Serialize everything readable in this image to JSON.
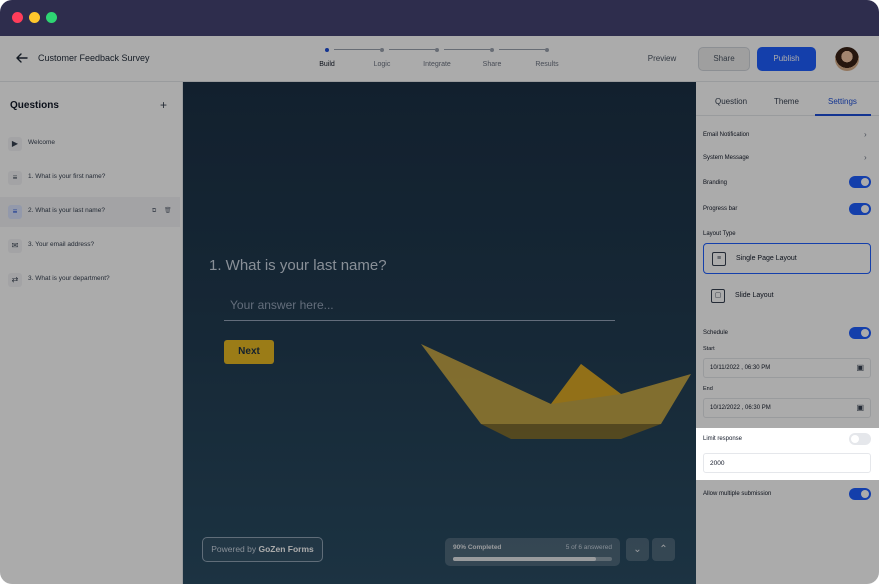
{
  "header": {
    "title": "Customer Feedback Survey",
    "steps": [
      {
        "label": "Build",
        "active": true
      },
      {
        "label": "Logic",
        "active": false
      },
      {
        "label": "Integrate",
        "active": false
      },
      {
        "label": "Share",
        "active": false
      },
      {
        "label": "Results",
        "active": false
      }
    ],
    "preview_label": "Preview",
    "share_label": "Share",
    "publish_label": "Publish"
  },
  "sidebar": {
    "title": "Questions",
    "add_icon": "plus-icon",
    "items": [
      {
        "label": "Welcome",
        "icon": "video-icon"
      },
      {
        "label": "1. What is your first name?",
        "icon": "short-text-icon"
      },
      {
        "label": "2. What is your last name?",
        "icon": "short-text-icon",
        "selected": true
      },
      {
        "label": "3. Your email address?",
        "icon": "email-icon"
      },
      {
        "label": "3. What is your department?",
        "icon": "dropdown-icon"
      }
    ]
  },
  "preview": {
    "question": "1. What is your last name?",
    "answer_placeholder": "Your answer here...",
    "next_label": "Next",
    "powered_prefix": "Powered by",
    "powered_brand": "GoZen Forms",
    "progress_label": "90% Completed",
    "progress_count": "5 of 6 answered",
    "progress_fraction": 0.9
  },
  "settings": {
    "tabs": [
      "Question",
      "Theme",
      "Settings"
    ],
    "active_tab": "Settings",
    "email_notification": "Email Notification",
    "system_message": "System Message",
    "branding": "Branding",
    "progress_bar": "Progress bar",
    "layout_type": "Layout Type",
    "single_page_layout": "Single Page Layout",
    "slide_layout": "Slide Layout",
    "schedule": "Schedule",
    "start_label": "Start",
    "start_value": "10/11/2022 , 06:30 PM",
    "end_label": "End",
    "end_value": "10/12/2022 , 06:30 PM",
    "limit_response": "Limit response",
    "limit_value": "2000",
    "allow_multiple": "Allow multiple submission"
  },
  "colors": {
    "accent": "#1e5eff",
    "next_button": "#e8b923",
    "titlebar": "#2e2d4d"
  }
}
